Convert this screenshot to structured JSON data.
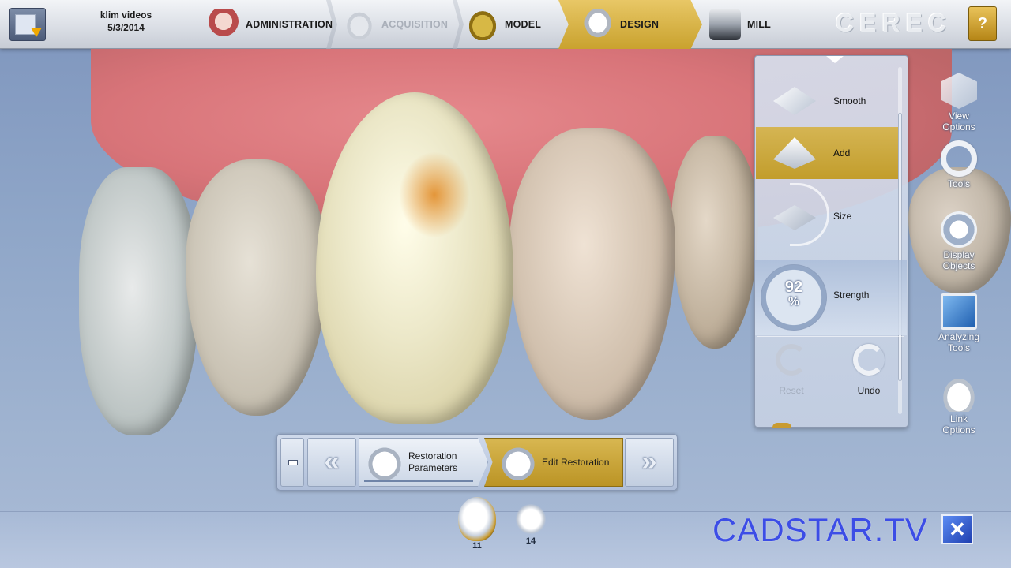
{
  "header": {
    "patient_name": "klim videos",
    "patient_date": "5/3/2014",
    "logo_text": "CEREC",
    "help_glyph": "?"
  },
  "phases": [
    {
      "label": "ADMINISTRATION",
      "icon": "dentures-icon",
      "state": "normal"
    },
    {
      "label": "ACQUISITION",
      "icon": "scan-icon",
      "state": "disabled"
    },
    {
      "label": "MODEL",
      "icon": "model-icon",
      "state": "normal"
    },
    {
      "label": "DESIGN",
      "icon": "crown-icon",
      "state": "active"
    },
    {
      "label": "MILL",
      "icon": "mill-icon",
      "state": "normal"
    }
  ],
  "tools": {
    "items": [
      {
        "label": "Smooth",
        "icon": "smooth-icon",
        "selected": false
      },
      {
        "label": "Add",
        "icon": "add-material-icon",
        "selected": true
      },
      {
        "label": "Size",
        "icon": "size-icon",
        "selected": false
      },
      {
        "label": "Strength",
        "icon": "strength-dial-icon",
        "selected": false
      }
    ],
    "strength_value": "92",
    "strength_unit": "%",
    "reset_label": "Reset",
    "undo_label": "Undo"
  },
  "sidebar": {
    "items": [
      {
        "line1": "View",
        "line2": "Options",
        "icon": "cube-icon"
      },
      {
        "line1": "Tools",
        "line2": "",
        "icon": "tools-ring-icon"
      },
      {
        "line1": "Display",
        "line2": "Objects",
        "icon": "display-objects-icon"
      },
      {
        "line1": "Analyzing",
        "line2": "Tools",
        "icon": "analyzing-icon"
      },
      {
        "line1": "Link",
        "line2": "Options",
        "icon": "link-teeth-icon"
      }
    ]
  },
  "steps": {
    "prev_glyph": "«",
    "next_glyph": "»",
    "items": [
      {
        "line1": "Restoration",
        "line2": "Parameters",
        "state": "done"
      },
      {
        "line1": "Edit Restoration",
        "line2": "",
        "state": "active"
      }
    ]
  },
  "restorations": [
    {
      "number": "11",
      "selected": true
    },
    {
      "number": "14",
      "selected": false
    }
  ],
  "watermark": {
    "text": "CADSTAR.TV",
    "box_glyph": "✕"
  },
  "colors": {
    "accent_gold": "#c9a22e",
    "watermark_blue": "#3c4de6",
    "background_blue": "#8fa6c8"
  }
}
